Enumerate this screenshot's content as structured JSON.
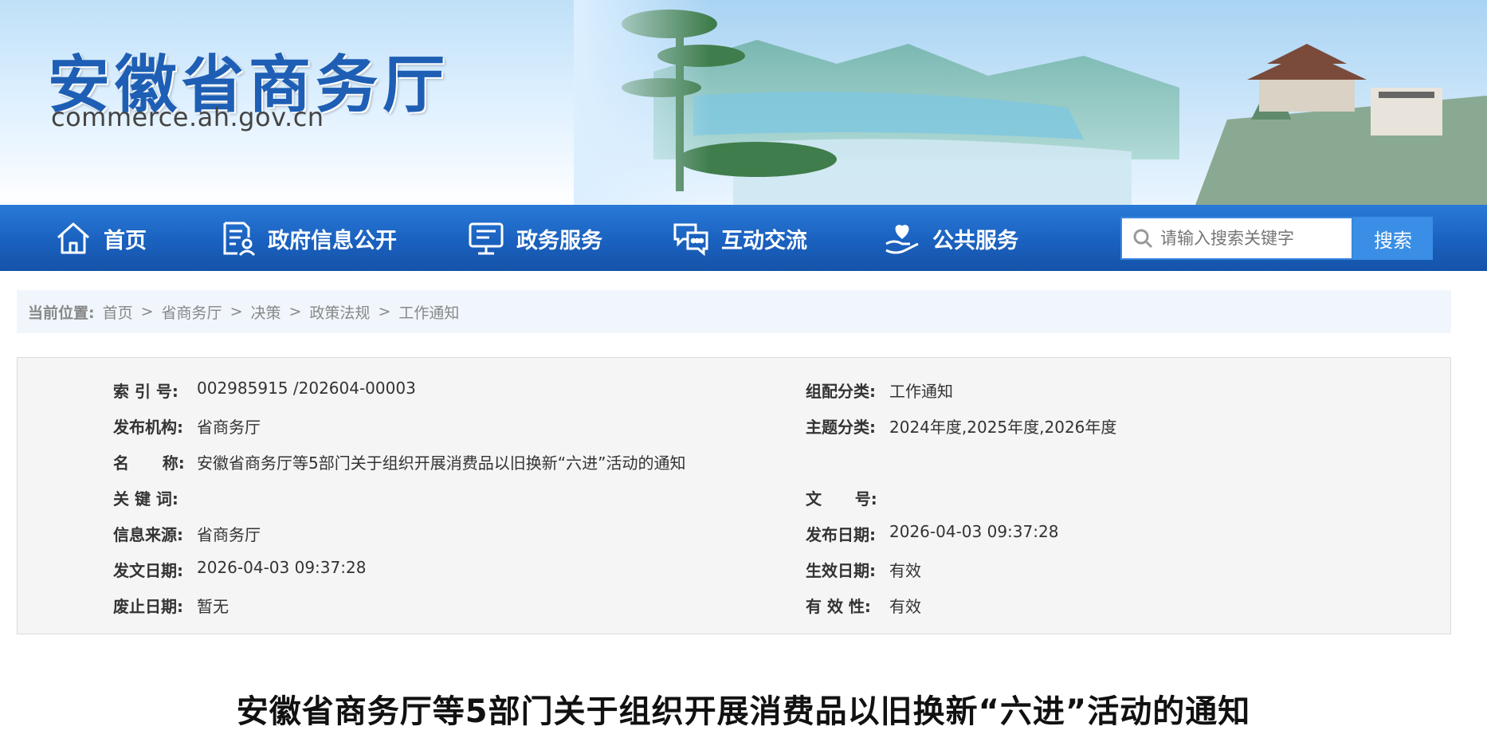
{
  "header": {
    "site_title": "安徽省商务厅",
    "site_domain": "commerce.ah.gov.cn"
  },
  "nav": {
    "items": [
      {
        "label": "首页",
        "icon": "home-icon"
      },
      {
        "label": "政府信息公开",
        "icon": "document-user-icon"
      },
      {
        "label": "政务服务",
        "icon": "monitor-icon"
      },
      {
        "label": "互动交流",
        "icon": "chat-icon"
      },
      {
        "label": "公共服务",
        "icon": "heart-hand-icon"
      }
    ],
    "search_placeholder": "请输入搜索关键字",
    "search_button": "搜索"
  },
  "breadcrumb": {
    "label": "当前位置:",
    "items": [
      "首页",
      "省商务厅",
      "决策",
      "政策法规",
      "工作通知"
    ],
    "separator": ">"
  },
  "meta": {
    "left": [
      {
        "key": "索 引 号:",
        "value": "002985915 /202604-00003"
      },
      {
        "key": "发布机构:",
        "value": "省商务厅"
      },
      {
        "key": "名      称:",
        "value": "安徽省商务厅等5部门关于组织开展消费品以旧换新“六进”活动的通知"
      },
      {
        "key": "关 键 词:",
        "value": ""
      },
      {
        "key": "信息来源:",
        "value": "省商务厅"
      },
      {
        "key": "发文日期:",
        "value": "2026-04-03 09:37:28"
      },
      {
        "key": "废止日期:",
        "value": "暂无"
      }
    ],
    "right": [
      {
        "key": "组配分类:",
        "value": "工作通知"
      },
      {
        "key": "主题分类:",
        "value": "2024年度,2025年度,2026年度"
      },
      {
        "key": "文      号:",
        "value": ""
      },
      {
        "key": "发布日期:",
        "value": "2026-04-03 09:37:28"
      },
      {
        "key": "生效日期:",
        "value": "有效"
      },
      {
        "key": "有 效 性:",
        "value": "有效"
      }
    ]
  },
  "article": {
    "title": "安徽省商务厅等5部门关于组织开展消费品以旧换新“六进”活动的通知"
  },
  "colors": {
    "nav_blue": "#1a61bf",
    "logo_blue": "#1e5fb5",
    "search_button": "#3a8ee6"
  }
}
